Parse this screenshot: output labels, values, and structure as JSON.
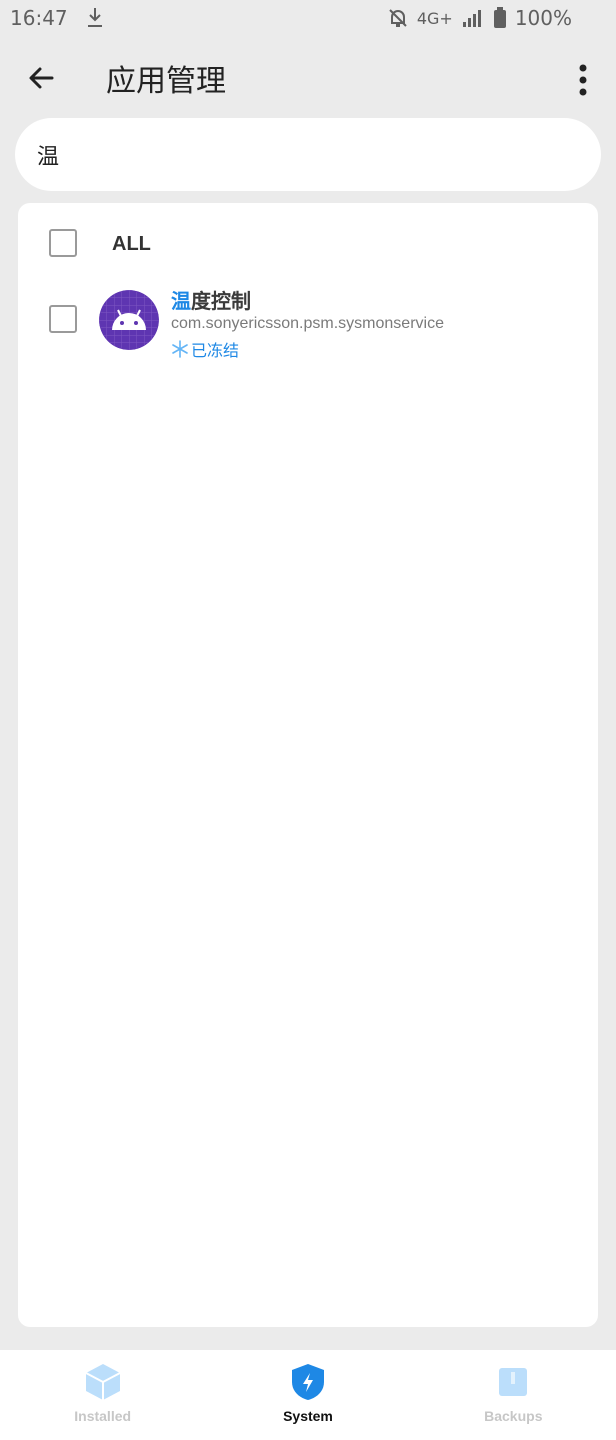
{
  "status": {
    "time": "16:47",
    "network": "4G+",
    "battery": "100%"
  },
  "header": {
    "title": "应用管理"
  },
  "search": {
    "value": "温"
  },
  "list": {
    "all_label": "ALL",
    "items": [
      {
        "name_highlight": "温",
        "name_rest": "度控制",
        "package": "com.sonyericsson.psm.sysmonservice",
        "state": "已冻结",
        "icon": "android-icon"
      }
    ]
  },
  "nav": {
    "items": [
      {
        "label": "Installed",
        "icon": "cube-icon"
      },
      {
        "label": "System",
        "icon": "shield-bolt-icon"
      },
      {
        "label": "Backups",
        "icon": "archive-icon"
      }
    ],
    "active": "System"
  },
  "colors": {
    "accent": "#1e88e5",
    "icon_bg": "#5e35b1"
  }
}
